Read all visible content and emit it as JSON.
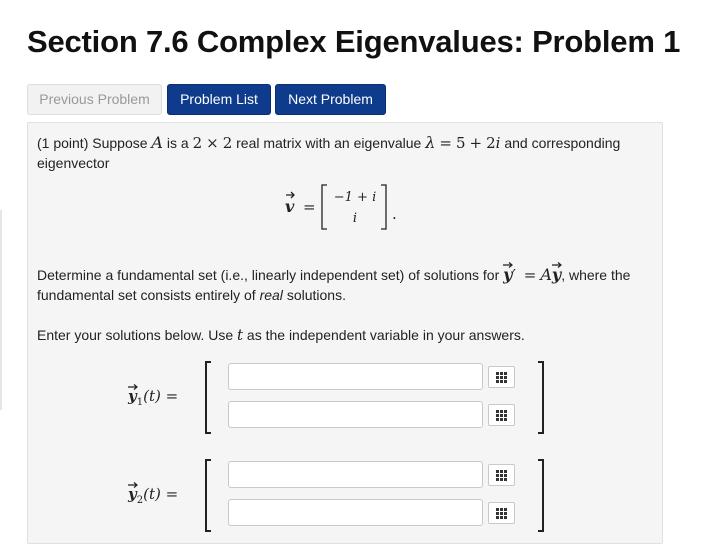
{
  "header": {
    "title": "Section 7.6 Complex Eigenvalues: Problem 1"
  },
  "nav": {
    "previous_label": "Previous Problem",
    "list_label": "Problem List",
    "next_label": "Next Problem"
  },
  "problem": {
    "points": "(1 point)",
    "intro_1": "Suppose",
    "matrix_var": "A",
    "intro_2": "is a",
    "dim_a": "2",
    "times": "×",
    "dim_b": "2",
    "intro_3": "real matrix with an eigenvalue",
    "lambda": "λ",
    "eq": "=",
    "eig_real": "5",
    "plus": "+",
    "eig_imag": "2",
    "imag_unit": "i",
    "intro_4": "and corresponding",
    "intro_5": "eigenvector",
    "eigvec_label": "v",
    "eigvec_top": "−1 + i",
    "eigvec_bottom": "i",
    "period": ".",
    "q1_a": "Determine a fundamental set (i.e., linearly independent set) of solutions for",
    "yprime": "y",
    "prime": "′",
    "rhs_a": "A",
    "rhs_y": "y",
    "q1_b": ", where the",
    "q2_a": "fundamental set consists entirely of",
    "q2_real": "real",
    "q2_b": "solutions.",
    "enter_a": "Enter your solutions below. Use",
    "enter_t": "t",
    "enter_b": "as the independent variable in your answers."
  },
  "answers": [
    {
      "label_var": "y",
      "label_sub": "1",
      "label_arg": "(t) =",
      "field_1": "",
      "field_2": ""
    },
    {
      "label_var": "y",
      "label_sub": "2",
      "label_arg": "(t) =",
      "field_1": "",
      "field_2": ""
    }
  ],
  "icons": {
    "keypad": "keypad-icon"
  }
}
